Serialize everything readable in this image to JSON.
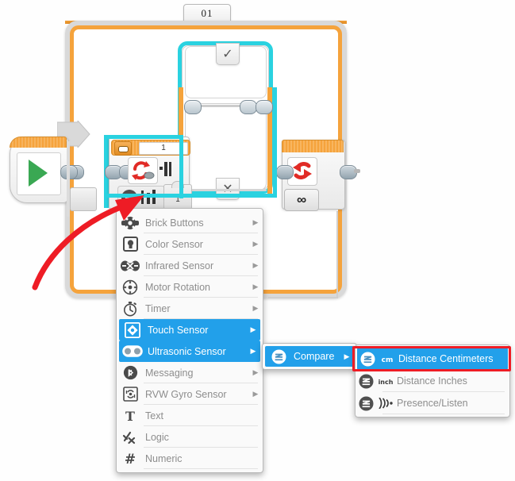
{
  "tab": {
    "label": "01"
  },
  "blocks": {
    "start": {
      "name": "start-block",
      "icon": "play-icon"
    },
    "wait_sensor": {
      "port_value": "1",
      "port_icon": "port-selector-icon",
      "mode_icon": "rotation-icon",
      "compare_icon": "compare-bars-icon",
      "stack_value": "1"
    },
    "switch": {
      "true_case": "✓",
      "false_case": "✕"
    },
    "loop_end": {
      "icon": "loop-return-icon",
      "count_label": "∞"
    }
  },
  "menu": {
    "items": [
      {
        "label": "Brick Buttons",
        "icon": "brick-buttons-icon",
        "arrow": "▶",
        "selected": false
      },
      {
        "label": "Color Sensor",
        "icon": "color-sensor-icon",
        "arrow": "▶",
        "selected": false
      },
      {
        "label": "Infrared Sensor",
        "icon": "infrared-sensor-icon",
        "arrow": "▶",
        "selected": false
      },
      {
        "label": "Motor Rotation",
        "icon": "motor-rotation-icon",
        "arrow": "▶",
        "selected": false
      },
      {
        "label": "Timer",
        "icon": "timer-icon",
        "arrow": "▶",
        "selected": false
      },
      {
        "label": "Touch Sensor",
        "icon": "touch-sensor-icon",
        "arrow": "▶",
        "selected": true
      },
      {
        "label": "Ultrasonic Sensor",
        "icon": "ultrasonic-sensor-icon",
        "arrow": "▶",
        "selected": true
      },
      {
        "label": "Messaging",
        "icon": "messaging-icon",
        "arrow": "▶",
        "selected": false
      },
      {
        "label": "RVW Gyro Sensor",
        "icon": "gyro-sensor-icon",
        "arrow": "▶",
        "selected": false
      },
      {
        "label": "Text",
        "icon": "text-icon",
        "arrow": "",
        "selected": false
      },
      {
        "label": "Logic",
        "icon": "logic-icon",
        "arrow": "",
        "selected": false
      },
      {
        "label": "Numeric",
        "icon": "numeric-icon",
        "arrow": "",
        "selected": false
      }
    ]
  },
  "submenu_compare": {
    "items": [
      {
        "label": "Compare",
        "icon": "ultrasonic-badge-icon",
        "arrow": "▶",
        "selected": true
      }
    ]
  },
  "submenu_mode": {
    "items": [
      {
        "label": "Distance Centimeters",
        "icon": "ultrasonic-badge-icon",
        "unit": "cm",
        "selected": true,
        "highlighted": true
      },
      {
        "label": "Distance Inches",
        "icon": "ultrasonic-badge-icon",
        "unit": "inch",
        "selected": false,
        "highlighted": false
      },
      {
        "label": "Presence/Listen",
        "icon": "ultrasonic-badge-icon",
        "unit": "waves",
        "selected": false,
        "highlighted": false
      }
    ]
  },
  "annotation": {
    "arrow": "red-curved-arrow",
    "highlight_box": "red-highlight-box"
  },
  "colors": {
    "selection_blue": "#22a0ea",
    "highlight_red": "#ee1c25",
    "loop_orange": "#f5a33c",
    "selected_cyan": "#2ad2e0",
    "start_green": "#3aa853"
  }
}
